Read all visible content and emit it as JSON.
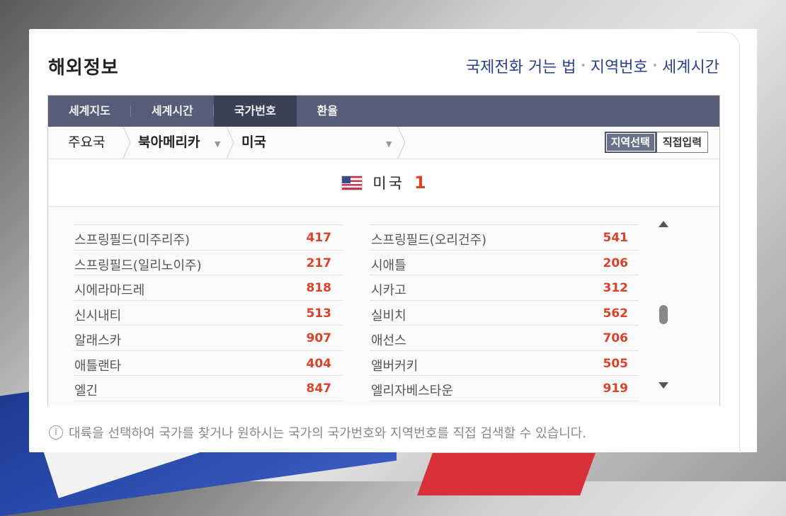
{
  "header": {
    "title": "해외정보",
    "links": [
      "국제전화 거는 법",
      "지역번호",
      "세계시간"
    ]
  },
  "tabs": [
    "세계지도",
    "세계시간",
    "국가번호",
    "환율"
  ],
  "active_tab": "국가번호",
  "breadcrumb": {
    "level1": "주요국",
    "level2": "북아메리카",
    "level3": "미국"
  },
  "toggle": {
    "region_select": "지역선택",
    "direct_input": "직접입력"
  },
  "country": {
    "name": "미국",
    "code": "1"
  },
  "list": {
    "left": [
      {
        "name": "스프링필드(미주리주)",
        "code": "417"
      },
      {
        "name": "스프링필드(일리노이주)",
        "code": "217"
      },
      {
        "name": "시에라마드레",
        "code": "818"
      },
      {
        "name": "신시내티",
        "code": "513"
      },
      {
        "name": "알래스카",
        "code": "907"
      },
      {
        "name": "애틀랜타",
        "code": "404"
      },
      {
        "name": "엘긴",
        "code": "847"
      }
    ],
    "right": [
      {
        "name": "스프링필드(오리건주)",
        "code": "541"
      },
      {
        "name": "시애틀",
        "code": "206"
      },
      {
        "name": "시카고",
        "code": "312"
      },
      {
        "name": "실비치",
        "code": "562"
      },
      {
        "name": "애선스",
        "code": "706"
      },
      {
        "name": "앨버커키",
        "code": "505"
      },
      {
        "name": "엘리자베스타운",
        "code": "919"
      }
    ]
  },
  "notice": "대륙을 선택하여 국가를 찾거나 원하시는 국가의 국가번호와 지역번호를 직접 검색할 수 있습니다.",
  "colors": {
    "tab_bg": "#575d79",
    "tab_active": "#3b4057",
    "link": "#2a3f8e",
    "code": "#d9432a"
  }
}
